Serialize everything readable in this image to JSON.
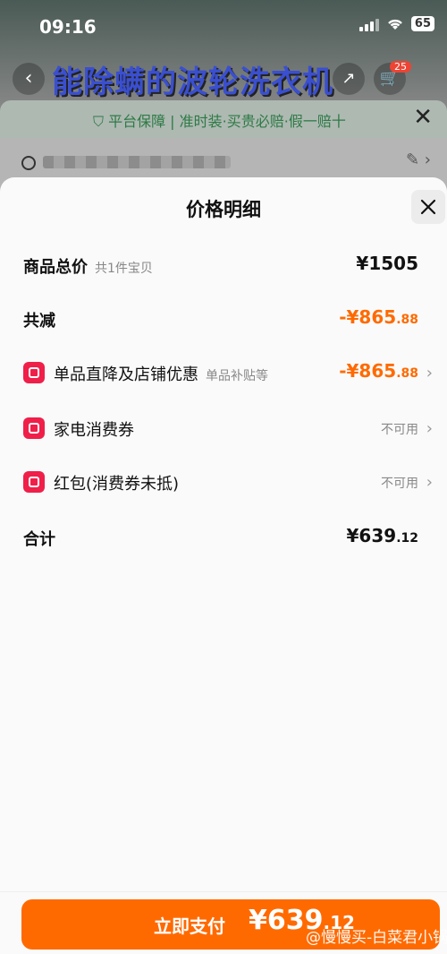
{
  "status_bar": {
    "time": "09:16",
    "battery": "65"
  },
  "background": {
    "headline": "能除螨的波轮洗衣机",
    "cart_badge": "25",
    "guarantee_text": "平台保障 | 准时装·买贵必赔·假一赔十"
  },
  "sheet": {
    "title": "价格明细",
    "rows": [
      {
        "label": "商品总价",
        "sub": "共1件宝贝",
        "value": "¥1505"
      },
      {
        "label": "共减",
        "value_int": "-¥865",
        "value_dec": ".88"
      },
      {
        "label": "单品直降及店铺优惠",
        "sub": "单品补贴等",
        "value_int": "-¥865",
        "value_dec": ".88",
        "icon": "shop-discount-icon"
      },
      {
        "label": "家电消费券",
        "status": "不可用",
        "icon": "appliance-coupon-icon"
      },
      {
        "label": "红包(消费券未抵)",
        "status": "不可用",
        "icon": "red-packet-icon"
      },
      {
        "label": "合计",
        "value_int": "¥639",
        "value_dec": ".12"
      }
    ]
  },
  "footer": {
    "pay_label": "立即支付",
    "pay_int": "¥639",
    "pay_dec": ".12",
    "watermark": "@慢慢买-白菜君小锅"
  },
  "colors": {
    "accent": "#ff6a00",
    "icon_red": "#ef1f49"
  }
}
